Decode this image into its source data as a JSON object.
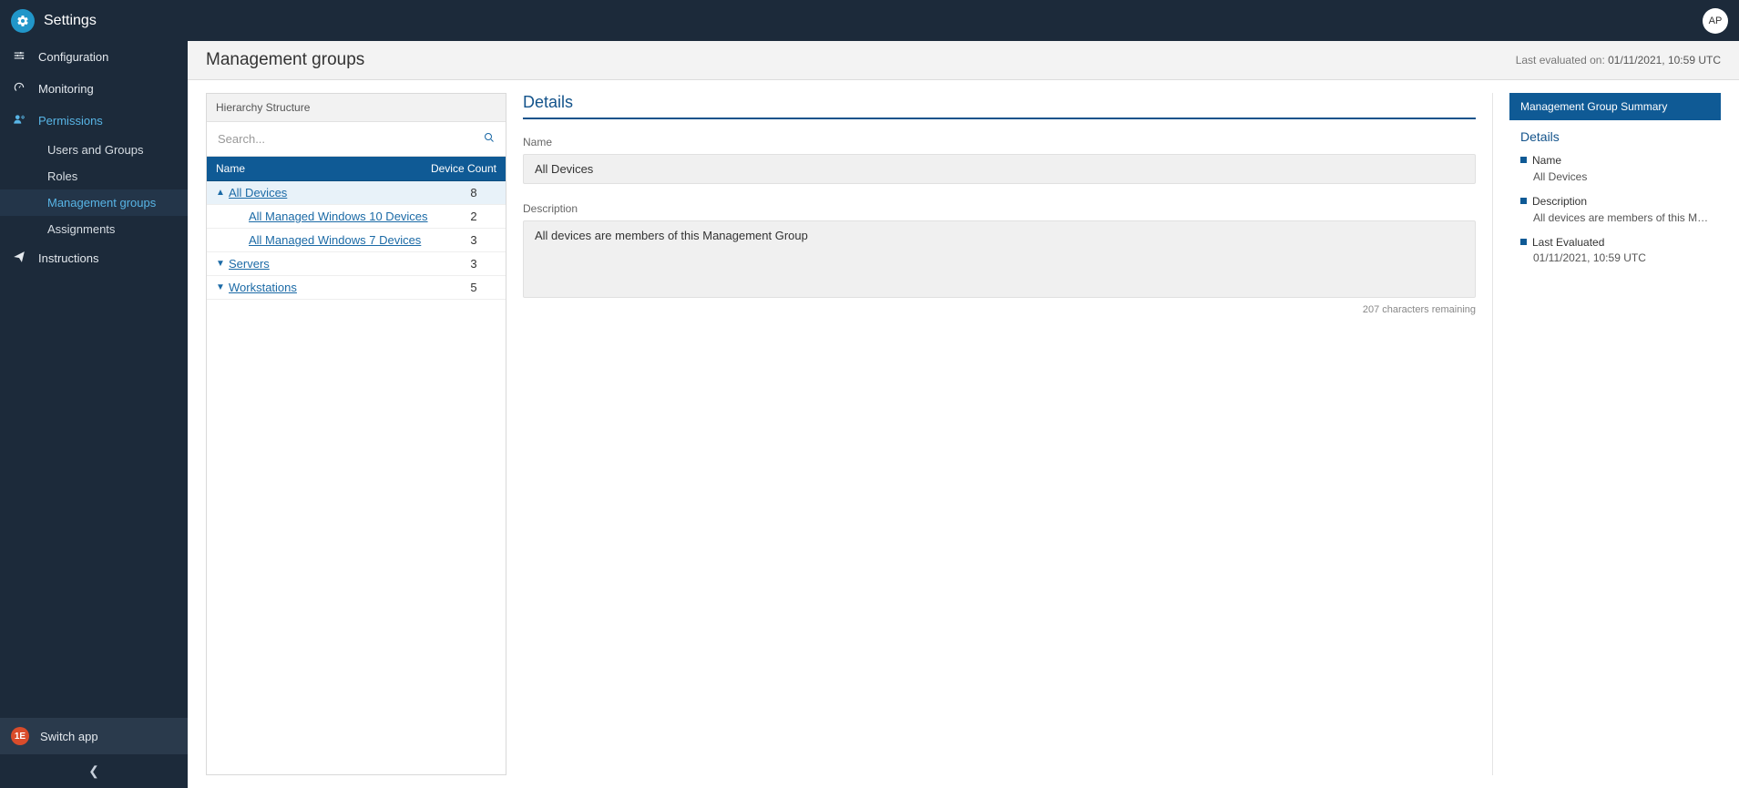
{
  "topbar": {
    "app_title": "Settings",
    "avatar_initials": "AP"
  },
  "sidebar": {
    "items": [
      {
        "label": "Configuration",
        "icon": "sliders",
        "active": false
      },
      {
        "label": "Monitoring",
        "icon": "gauge",
        "active": false
      },
      {
        "label": "Permissions",
        "icon": "user-gear",
        "active": true
      },
      {
        "label": "Instructions",
        "icon": "paper-plane",
        "active": false
      }
    ],
    "permissions_sub": [
      {
        "label": "Users and Groups",
        "active": false
      },
      {
        "label": "Roles",
        "active": false
      },
      {
        "label": "Management groups",
        "active": true
      },
      {
        "label": "Assignments",
        "active": false
      }
    ],
    "switch_app": "Switch app"
  },
  "page": {
    "title": "Management groups",
    "last_evaluated_label": "Last evaluated on:",
    "last_evaluated_value": "01/11/2021, 10:59 UTC"
  },
  "hierarchy": {
    "panel_title": "Hierarchy Structure",
    "search_placeholder": "Search...",
    "columns": {
      "name": "Name",
      "count": "Device Count"
    },
    "rows": [
      {
        "indent": 0,
        "chevron": "up",
        "label": "All Devices",
        "count": 8,
        "selected": true
      },
      {
        "indent": 1,
        "chevron": "",
        "label": "All Managed Windows 10 Devices",
        "count": 2,
        "selected": false
      },
      {
        "indent": 1,
        "chevron": "",
        "label": "All Managed Windows 7 Devices",
        "count": 3,
        "selected": false
      },
      {
        "indent": 0,
        "chevron": "down",
        "label": "Servers",
        "count": 3,
        "selected": false
      },
      {
        "indent": 0,
        "chevron": "down",
        "label": "Workstations",
        "count": 5,
        "selected": false
      }
    ]
  },
  "details": {
    "heading": "Details",
    "name_label": "Name",
    "name_value": "All Devices",
    "description_label": "Description",
    "description_value": "All devices are members of this Management Group",
    "chars_remaining": "207 characters remaining"
  },
  "summary": {
    "header": "Management Group Summary",
    "subheading": "Details",
    "items": [
      {
        "label": "Name",
        "value": "All Devices"
      },
      {
        "label": "Description",
        "value": "All devices are members of this Manag..."
      },
      {
        "label": "Last Evaluated",
        "value": "01/11/2021, 10:59 UTC"
      }
    ]
  }
}
